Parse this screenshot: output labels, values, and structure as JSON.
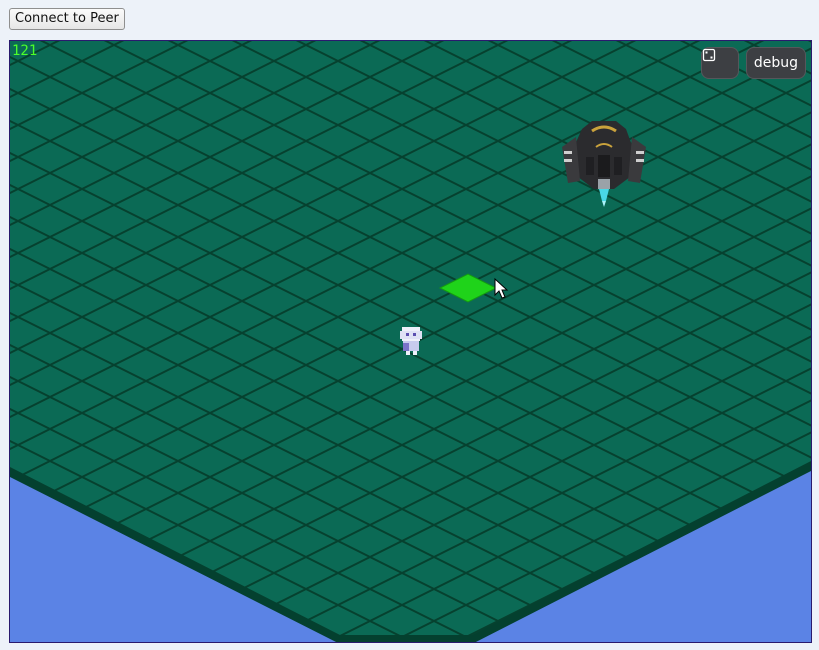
{
  "toolbar": {
    "connect_label": "Connect to Peer"
  },
  "hud": {
    "fps": "121",
    "debug_label": "debug",
    "fullscreen_icon": "fullscreen-icon"
  },
  "colors": {
    "water": "#5b83e5",
    "tile": "#0b6a55",
    "tile_line": "#06412f",
    "highlight": "#1fd31a"
  }
}
